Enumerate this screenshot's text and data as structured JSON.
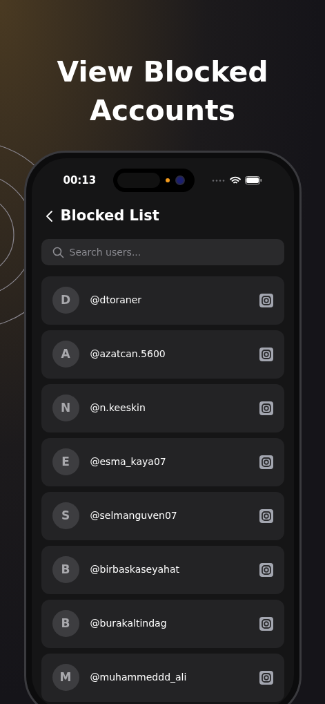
{
  "headline": "View Blocked Accounts",
  "status_bar": {
    "time": "00:13"
  },
  "header": {
    "title": "Blocked List"
  },
  "search": {
    "placeholder": "Search users..."
  },
  "users": [
    {
      "initial": "D",
      "handle": "@dtoraner"
    },
    {
      "initial": "A",
      "handle": "@azatcan.5600"
    },
    {
      "initial": "N",
      "handle": "@n.keeskin"
    },
    {
      "initial": "E",
      "handle": "@esma_kaya07"
    },
    {
      "initial": "S",
      "handle": "@selmanguven07"
    },
    {
      "initial": "B",
      "handle": "@birbaskaseyahat"
    },
    {
      "initial": "B",
      "handle": "@burakaltindag"
    },
    {
      "initial": "M",
      "handle": "@muhammeddd_ali"
    }
  ]
}
